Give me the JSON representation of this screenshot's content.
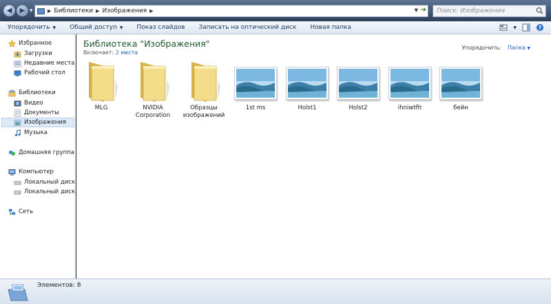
{
  "window": {
    "breadcrumbs": [
      "Библиотеки",
      "Изображения"
    ],
    "search_placeholder": "Поиск: Изображения"
  },
  "toolbar": {
    "organize": "Упорядочить",
    "share": "Общий доступ",
    "slideshow": "Показ слайдов",
    "burn": "Записать на оптический диск",
    "new_folder": "Новая папка"
  },
  "sidebar": {
    "favorites": "Избранное",
    "downloads": "Загрузки",
    "recent": "Недавние места",
    "desktop": "Рабочий стол",
    "libraries": "Библиотеки",
    "video": "Видео",
    "documents": "Документы",
    "images": "Изображения",
    "music": "Музыка",
    "homegroup": "Домашняя группа",
    "computer": "Компьютер",
    "disk_c": "Локальный диск (C",
    "disk_d": "Локальный диск (D",
    "network": "Сеть"
  },
  "content": {
    "title": "Библиотека \"Изображения\"",
    "includes_label": "Включает:",
    "includes_link": "2 места",
    "arrange_label": "Упорядочить:",
    "arrange_value": "Папка",
    "items": [
      {
        "name": "MLG",
        "type": "folder"
      },
      {
        "name": "NVIDIA Corporation",
        "type": "folder"
      },
      {
        "name": "Образцы изображений",
        "type": "folder"
      },
      {
        "name": "1st ms",
        "type": "image"
      },
      {
        "name": "Holst1",
        "type": "image"
      },
      {
        "name": "Holst2",
        "type": "image"
      },
      {
        "name": "ihniwtfit",
        "type": "image"
      },
      {
        "name": "бейн",
        "type": "image"
      }
    ]
  },
  "status": {
    "count": "Элементов: 8"
  },
  "colors": {
    "title_green": "#1e5a2c",
    "link_blue": "#1f5fb8",
    "toolbar_text": "#1e395b",
    "selected_bg": "#dce9f7"
  }
}
